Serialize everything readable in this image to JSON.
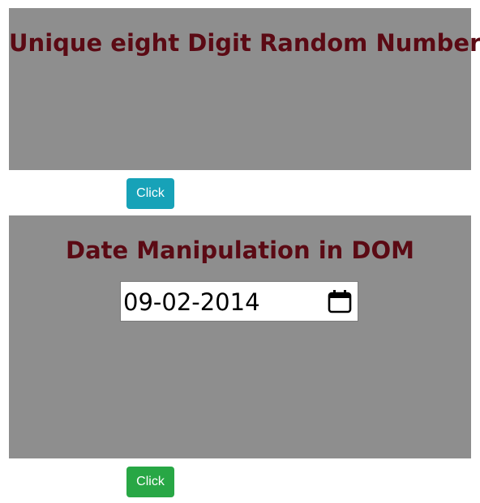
{
  "random_section": {
    "title": "Unique eight Digit Random Number",
    "button_label": "Click",
    "button_color": "#17a2b8"
  },
  "date_section": {
    "title": "Date Manipulation in DOM",
    "date_value": "09-02-2014",
    "date_icon": "calendar-icon",
    "button_label": "Click",
    "button_color": "#28a745"
  },
  "colors": {
    "panel_background": "#8e8e8e",
    "title_color": "#5b0a14"
  }
}
